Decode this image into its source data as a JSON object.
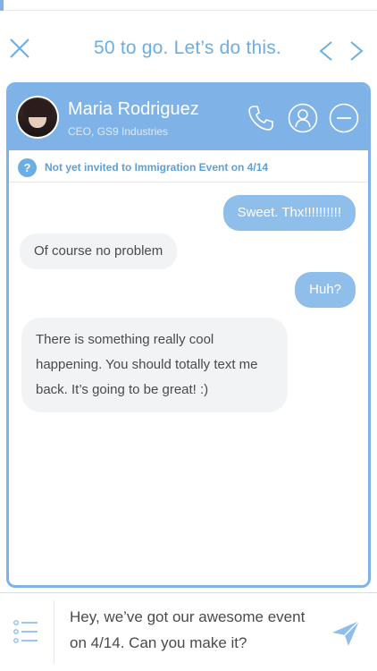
{
  "progress": {
    "fraction": 0.01
  },
  "top_bar": {
    "title": "50 to go. Let’s do this."
  },
  "contact": {
    "name": "Maria Rodriguez",
    "subtitle": "CEO, GS9 Industries"
  },
  "notice": {
    "text": "Not yet invited to Immigration Event on 4/14",
    "help_glyph": "?"
  },
  "messages": [
    {
      "direction": "outgoing",
      "text": "Sweet. Thx!!!!!!!!!!"
    },
    {
      "direction": "incoming",
      "text": "Of course no problem"
    },
    {
      "direction": "outgoing",
      "text": "Huh?"
    },
    {
      "direction": "incoming",
      "text": "There is something really cool happening. You should totally text me back. It’s going to be great! :)"
    }
  ],
  "composer": {
    "value": "Hey, we’ve got our awesome event on 4/14. Can you make it?"
  },
  "colors": {
    "accent": "#7fb3e8",
    "outgoing_bubble": "#8fbeea",
    "incoming_bubble": "#f1f3f5",
    "title_text": "#6aaee5"
  },
  "icons": {
    "close": "close-icon",
    "prev": "chevron-left-icon",
    "next": "chevron-right-icon",
    "phone": "phone-icon",
    "profile": "profile-icon",
    "remove": "minus-circle-icon",
    "help": "help-icon",
    "list": "list-icon",
    "send": "send-icon"
  }
}
